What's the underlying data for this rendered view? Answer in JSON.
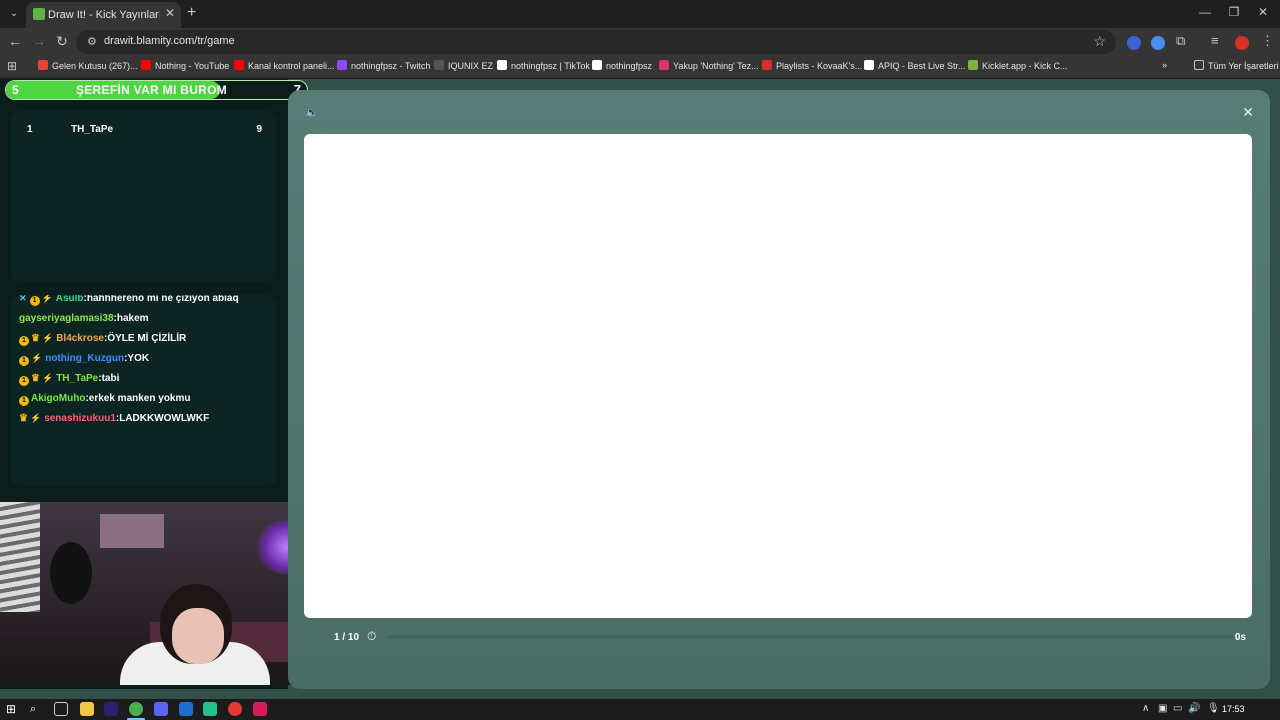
{
  "browser": {
    "tab": {
      "title": "Draw It! - Kick Yayınları İçin Çizim",
      "close": "✕"
    },
    "new_tab": "+",
    "window_controls": {
      "minimize": "—",
      "restore": "❐",
      "close": "✕"
    },
    "nav": {
      "back": "←",
      "forward": "→",
      "reload": "↻"
    },
    "url": "drawit.blamity.com/tr/game",
    "bookmarks": [
      {
        "label": "Gelen Kutusu (267)...",
        "icon": "gmail-icon",
        "color": "#ea4335"
      },
      {
        "label": "Nothing - YouTube",
        "icon": "youtube-icon",
        "color": "#ff0000"
      },
      {
        "label": "Kanal kontrol paneli...",
        "icon": "youtube-studio-icon",
        "color": "#ff0000"
      },
      {
        "label": "nothingfpsz - Twitch",
        "icon": "twitch-icon",
        "color": "#9146ff"
      },
      {
        "label": "IQUNIX EZ",
        "icon": "iqunix-icon",
        "color": "#555555"
      },
      {
        "label": "nothingfpsz | TikTok",
        "icon": "tiktok-icon",
        "color": "#ffffff"
      },
      {
        "label": "nothingfpsz",
        "icon": "x-icon",
        "color": "#ffffff"
      },
      {
        "label": "Yakup 'Nothing' Tez...",
        "icon": "instagram-icon",
        "color": "#e1306c"
      },
      {
        "label": "Playlists - KovaaK's...",
        "icon": "kovaaks-icon",
        "color": "#d32f2f"
      },
      {
        "label": "APIQ - Best Live Str...",
        "icon": "apiq-icon",
        "color": "#ffffff"
      },
      {
        "label": "Kicklet.app - Kick C...",
        "icon": "kicklet-icon",
        "color": "#7cb342"
      }
    ],
    "bookmarks_overflow": "»",
    "all_bookmarks": "Tüm Yer İşaretleri"
  },
  "game": {
    "word_bar": {
      "left_count": "5",
      "word": "ŞEREFİN VAR MI BUROM",
      "right_count": "7",
      "progress": 0.71
    },
    "leaderboard": [
      {
        "rank": "1",
        "name": "TH_TaPe",
        "score": "9"
      }
    ],
    "chat": [
      {
        "badges": [
          "x",
          "1",
          "bolt"
        ],
        "user": "Asulb",
        "user_color": "#3ad68c",
        "text": ":hahhhereno mi ne çiziyon abiaq"
      },
      {
        "badges": [],
        "user": "gayseriyaglamasi38",
        "user_color": "#8fe64a",
        "text": ":hakem"
      },
      {
        "badges": [
          "1",
          "crown",
          "bolt"
        ],
        "user": "Bl4ckrose",
        "user_color": "#f5a742",
        "text": ":ÖYLE Mİ ÇİZİLİR"
      },
      {
        "badges": [
          "1",
          "bolt"
        ],
        "user": "nothing_Kuzgun",
        "user_color": "#3c8cff",
        "text": ":YOK"
      },
      {
        "badges": [
          "1",
          "crown",
          "bolt"
        ],
        "user": "TH_TaPe",
        "user_color": "#7ee83d",
        "text": ":tabi"
      },
      {
        "badges": [
          "1"
        ],
        "user": "AkigoMuho",
        "user_color": "#7ee83d",
        "text": ":erkek manken yokmu"
      },
      {
        "badges": [
          "crown",
          "bolt"
        ],
        "user": "senashizukuu1",
        "user_color": "#ff5d7a",
        "text": ":LADKKWOWLWKF"
      }
    ],
    "sound_icon": "🔈",
    "close_icon": "✕",
    "round": "1 / 10",
    "timer_icon": "⏱",
    "timer_value": "0s",
    "timer_progress": 0.0
  },
  "taskbar": {
    "clock": "17:53",
    "tray_overflow": "∧"
  }
}
